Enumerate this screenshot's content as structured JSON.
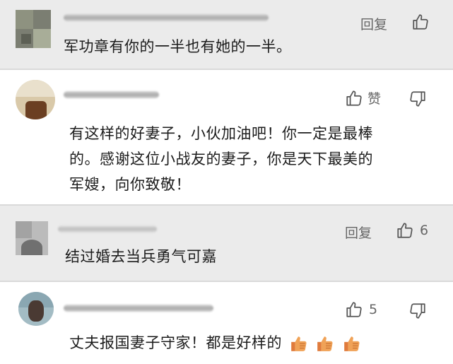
{
  "comments": [
    {
      "text": "军功章有你的一半也有她的一半。",
      "reply_label": "回复"
    },
    {
      "text": "有这样的好妻子，小伙加油吧！你一定是最棒\n的。感谢这位小战友的妻子，你是天下最美的\n军嫂，向你致敬！",
      "like_label": "赞"
    },
    {
      "text": "结过婚去当兵勇气可嘉",
      "reply_label": "回复",
      "like_count": "6"
    },
    {
      "text": "丈夫报国妻子守家！都是好样的",
      "like_count": "5"
    }
  ],
  "icons": [
    "thumb-up-icon",
    "thumb-down-icon",
    "thumbs-up-emoji"
  ],
  "colors": {
    "gray_bg": "#ebebeb",
    "white_bg": "#ffffff",
    "text": "#1c1c1c",
    "meta": "#666666",
    "emoji": "#f0a257"
  }
}
